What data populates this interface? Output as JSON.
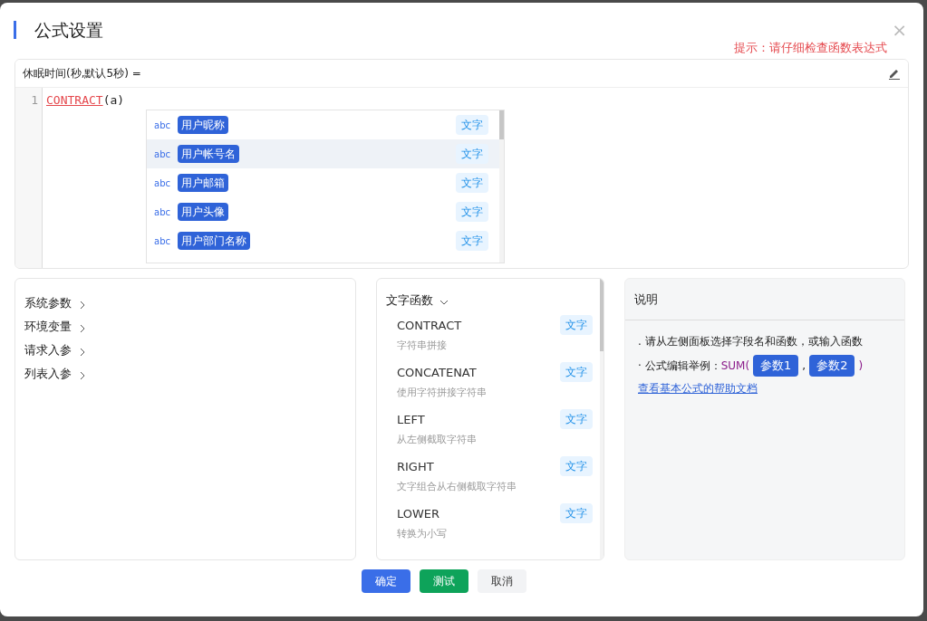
{
  "dialog": {
    "title": "公式设置",
    "hint": "提示：请仔细检查函数表达式",
    "close": "×"
  },
  "editor": {
    "label": "休眠时间(秒,默认5秒) =",
    "lines": [
      {
        "number": "1",
        "function": "CONTRACT",
        "rest": "(a)"
      }
    ],
    "suggestions": [
      {
        "type_icon": "abc",
        "name": "用户昵称",
        "tag": "文字",
        "selected": false
      },
      {
        "type_icon": "abc",
        "name": "用户帐号名",
        "tag": "文字",
        "selected": true
      },
      {
        "type_icon": "abc",
        "name": "用户邮箱",
        "tag": "文字",
        "selected": false
      },
      {
        "type_icon": "abc",
        "name": "用户头像",
        "tag": "文字",
        "selected": false
      },
      {
        "type_icon": "abc",
        "name": "用户部门名称",
        "tag": "文字",
        "selected": false
      }
    ]
  },
  "field_groups": [
    {
      "label": "系统参数",
      "expanded": false
    },
    {
      "label": "环境变量",
      "expanded": false
    },
    {
      "label": "请求入参",
      "expanded": false
    },
    {
      "label": "列表入参",
      "expanded": false
    }
  ],
  "functions": {
    "group": "文字函数",
    "expanded": true,
    "items": [
      {
        "name": "CONTRACT",
        "description": "字符串拼接",
        "tag": "文字"
      },
      {
        "name": "CONCATENAT",
        "description": "使用字符拼接字符串",
        "tag": "文字"
      },
      {
        "name": "LEFT",
        "description": "从左侧截取字符串",
        "tag": "文字"
      },
      {
        "name": "RIGHT",
        "description": "文字组合从右侧截取字符串",
        "tag": "文字"
      },
      {
        "name": "LOWER",
        "description": "转换为小写",
        "tag": "文字"
      }
    ]
  },
  "help": {
    "title": "说明",
    "line1": ". 请从左侧面板选择字段名和函数，或输入函数",
    "example_label": "· 公式编辑举例：",
    "example_fn": "SUM(",
    "param1": "参数1",
    "comma": ",",
    "param2": "参数2",
    "close_paren": ")",
    "link": "查看基本公式的帮助文档"
  },
  "buttons": [
    {
      "label": "确定",
      "kind": "primary"
    },
    {
      "label": "测试",
      "kind": "success"
    },
    {
      "label": "取消",
      "kind": "default"
    }
  ]
}
